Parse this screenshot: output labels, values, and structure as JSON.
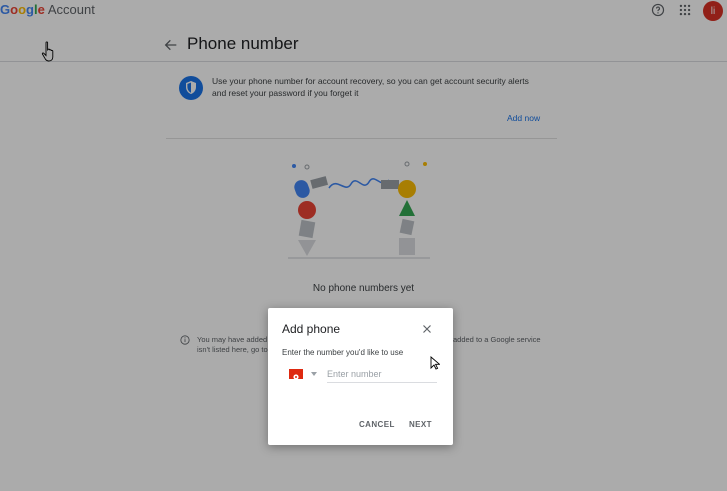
{
  "header": {
    "logo_google": "Google",
    "logo_account": "Account",
    "avatar_initial": "li",
    "help_icon": "help-circle-icon",
    "apps_icon": "apps-grid-icon"
  },
  "page": {
    "title": "Phone number",
    "info_text": "Use your phone number for account recovery, so you can get account security alerts and reset your password if you forget it",
    "add_now": "Add now",
    "empty_state": "No phone numbers yet",
    "note_left_1": "You may have added",
    "note_left_2": "isn't listed here, go to",
    "note_right_1": "added to a Google service"
  },
  "dialog": {
    "title": "Add phone",
    "label": "Enter the number you'd like to use",
    "input_placeholder": "Enter number",
    "input_value": "",
    "cancel": "CANCEL",
    "next": "NEXT"
  },
  "colors": {
    "accent": "#1a73e8",
    "avatar": "#d93025",
    "flag": "#de2910"
  }
}
